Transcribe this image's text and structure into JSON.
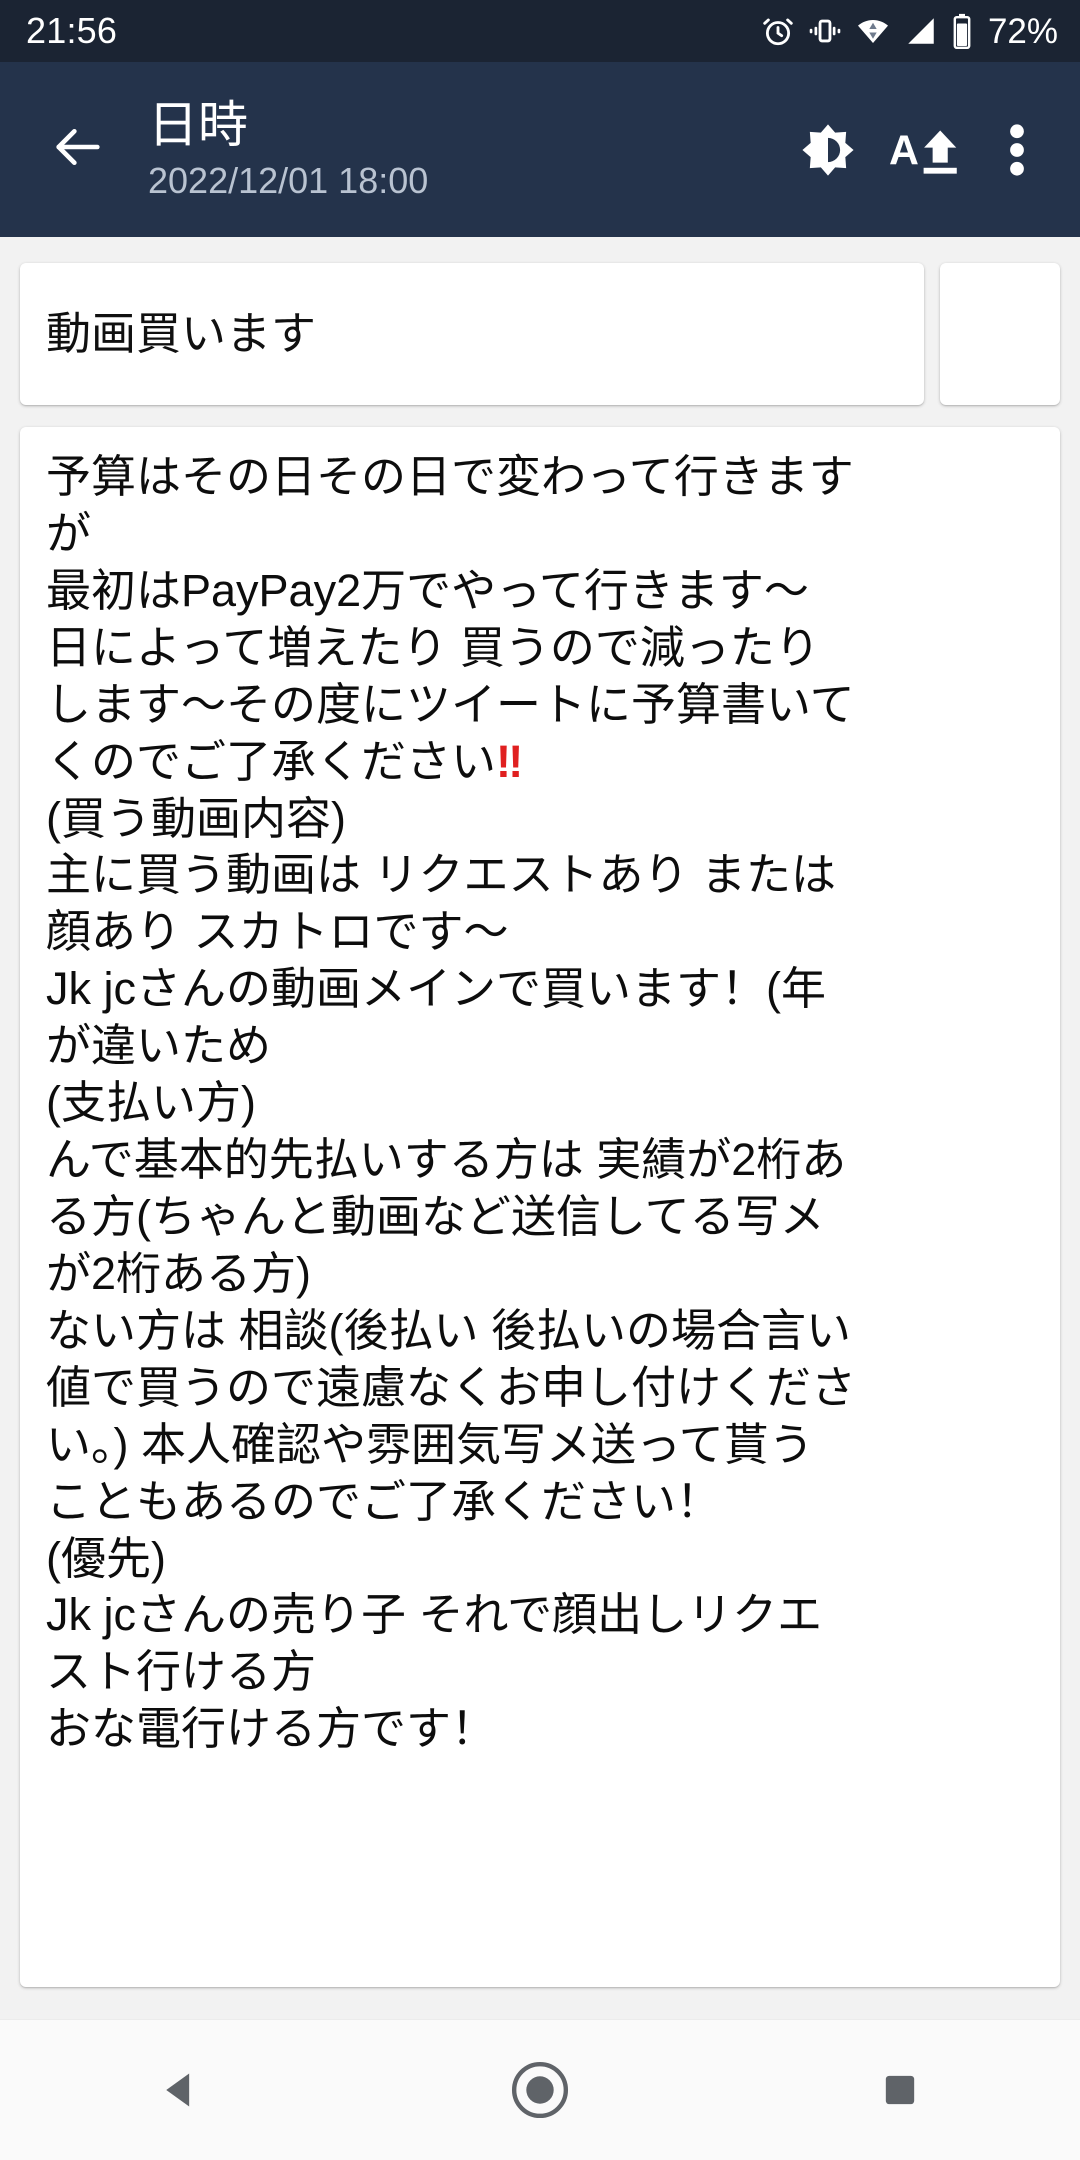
{
  "status_bar": {
    "time": "21:56",
    "battery_percent": "72%",
    "icons": [
      "alarm-icon",
      "vibrate-icon",
      "wifi-icon",
      "cellular-signal-icon",
      "battery-icon"
    ],
    "background_color": "#1b2433"
  },
  "app_bar": {
    "back_label": "back-arrow",
    "title": "日時",
    "subtitle": "2022/12/01  18:00",
    "background_color": "#24334b",
    "actions": [
      {
        "name": "brightness-icon",
        "label": "brightness"
      },
      {
        "name": "text-size-increase-icon",
        "label": "A"
      },
      {
        "name": "overflow-menu-icon",
        "label": "more options"
      }
    ]
  },
  "content": {
    "title_card": {
      "text": "動画買います"
    },
    "side_card": {
      "text": ""
    },
    "body_card": {
      "line_1": "予算はその日その日で変わって行きます",
      "line_2": "が",
      "line_3": "最初はPayPay2万でやって行きます〜",
      "line_4": "日によって増えたり 買うので減ったり",
      "line_5": "します〜その度にツイートに予算書いて",
      "line_6_pre": "くのでご了承ください",
      "line_6_emph": "‼",
      "line_7": "(買う動画内容)",
      "line_8": "主に買う動画は リクエストあり または",
      "line_9": "顔あり スカトロです〜",
      "line_10": "Jk jcさんの動画メインで買います！(年",
      "line_11": "が違いため",
      "line_12": "(支払い方)",
      "line_13": "んで基本的先払いする方は 実績が2桁あ",
      "line_14": "る方(ちゃんと動画など送信してる写メ",
      "line_15": "が2桁ある方)",
      "line_16": "ない方は 相談(後払い 後払いの場合言い",
      "line_17": "値で買うので遠慮なくお申し付けくださ",
      "line_18": "い。) 本人確認や雰囲気写メ送って貰う",
      "line_19": "こともあるのでご了承ください！",
      "line_20": "(優先)",
      "line_21": "Jk jcさんの売り子 それで顔出しリクエ",
      "line_22": "スト行ける方",
      "line_23": "おな電行ける方です！"
    }
  },
  "nav_bar": {
    "back": "back-triangle-icon",
    "home": "home-circle-icon",
    "recents": "recents-square-icon",
    "background_color": "#fafafa"
  }
}
